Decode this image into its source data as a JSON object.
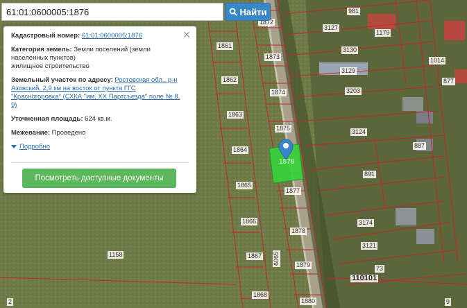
{
  "search": {
    "value": "61:01:0600005:1876",
    "button_label": "Найти",
    "icon": "search-icon"
  },
  "popup": {
    "cadastral_label": "Кадастровый номер:",
    "cadastral_value": "61:01:0600005:1876",
    "category_label": "Категория земель:",
    "category_value_1": "Земли поселений (земли",
    "category_value_2": "населенных пунктов)",
    "category_value_3": "жилищное строительство",
    "address_label": "Земельный участок по адресу:",
    "address_value_1": "Ростовская обл., р-н",
    "address_value_2": "Азовский, 2,9 км на восток от пункта ГГС",
    "address_value_3": "\"Красногоровка\" (СХКА \"им. XX Партсъезда\" поле № 8,",
    "address_value_4": "9)",
    "area_label": "Уточненная площадь:",
    "area_value": "624 кв.м.",
    "boundary_label": "Межевание:",
    "boundary_value": "Проведено",
    "more_label": "Подробно",
    "docs_button": "Посмотреть доступные документы",
    "close_icon": "close-icon"
  },
  "map": {
    "highlighted_parcel_label": "1876",
    "marker_icon": "map-pin-icon",
    "parcel_labels": [
      "1872",
      "981",
      "3127",
      "1179",
      "1861",
      "1873",
      "3130",
      "1014",
      "3129",
      "1862",
      "1874",
      "3203",
      "877",
      "1863",
      "1875",
      "3124",
      "887",
      "1864",
      "891",
      "1865",
      "1877",
      "1866",
      "3174",
      "1878",
      "3121",
      "1158",
      "1867",
      "6065",
      "1879",
      "73",
      "110101",
      "1868",
      "1880",
      "2",
      "9"
    ]
  }
}
